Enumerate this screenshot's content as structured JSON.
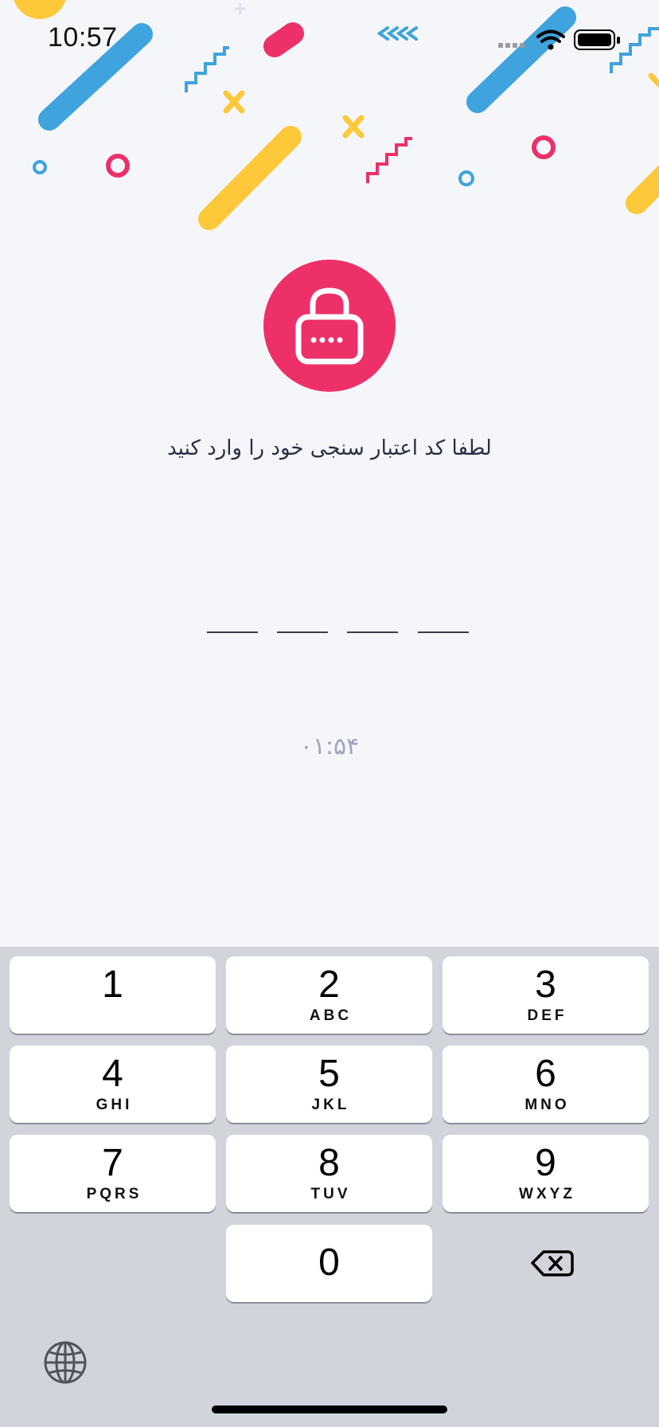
{
  "status_bar": {
    "time": "10:57",
    "icons": [
      "cellular-signal-icon",
      "wifi-icon",
      "battery-icon"
    ]
  },
  "header": {
    "lock_icon": "lock-with-dots-icon",
    "accent_color": "#ee3068"
  },
  "main": {
    "prompt": "لطفا کد اعتبار سنجی خود را وارد کنید",
    "code_digits": [
      "",
      "",
      "",
      ""
    ],
    "countdown": "۰۱:۵۴"
  },
  "keyboard": {
    "keys": [
      {
        "digit": "1",
        "letters": ""
      },
      {
        "digit": "2",
        "letters": "ABC"
      },
      {
        "digit": "3",
        "letters": "DEF"
      },
      {
        "digit": "4",
        "letters": "GHI"
      },
      {
        "digit": "5",
        "letters": "JKL"
      },
      {
        "digit": "6",
        "letters": "MNO"
      },
      {
        "digit": "7",
        "letters": "PQRS"
      },
      {
        "digit": "8",
        "letters": "TUV"
      },
      {
        "digit": "9",
        "letters": "WXYZ"
      },
      {
        "digit": "0",
        "letters": ""
      }
    ],
    "backspace_icon": "backspace-icon",
    "globe_icon": "globe-icon"
  }
}
